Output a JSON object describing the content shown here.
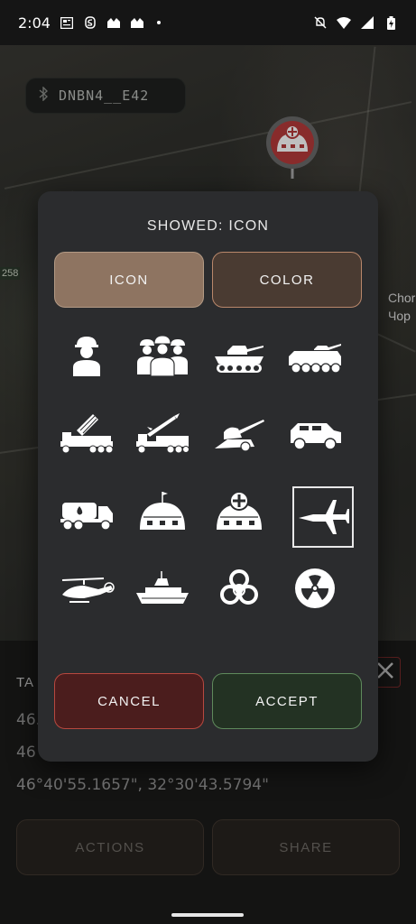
{
  "status_bar": {
    "time": "2:04",
    "left_icons": [
      "newspaper-icon",
      "s-app-icon",
      "sports-icon",
      "sports-icon",
      "dot-icon"
    ],
    "right_icons": [
      "mute-icon",
      "wifi-icon",
      "signal-icon",
      "battery-icon"
    ]
  },
  "map": {
    "device_chip": {
      "icon": "bluetooth-icon",
      "label": "DNBN4__E42"
    },
    "marker_icon": "field-hospital-icon",
    "side_text": [
      "Chor",
      "Чор"
    ],
    "number_tag": "258"
  },
  "bottom_panel": {
    "tag_label": "TA",
    "coords": [
      "46.",
      "46",
      "46°40'55.1657\", 32°30'43.5794\""
    ],
    "actions_label": "ACTIONS",
    "share_label": "SHARE"
  },
  "dialog": {
    "title": "SHOWED: ICON",
    "tab_icon_label": "ICON",
    "tab_color_label": "COLOR",
    "icons": [
      {
        "name": "soldier-icon",
        "selected": false
      },
      {
        "name": "squad-icon",
        "selected": false
      },
      {
        "name": "tank-icon",
        "selected": false
      },
      {
        "name": "apc-icon",
        "selected": false
      },
      {
        "name": "rocket-launcher-truck-icon",
        "selected": false
      },
      {
        "name": "missile-truck-icon",
        "selected": false
      },
      {
        "name": "artillery-icon",
        "selected": false
      },
      {
        "name": "armored-vehicle-icon",
        "selected": false
      },
      {
        "name": "fuel-truck-icon",
        "selected": false
      },
      {
        "name": "hangar-icon",
        "selected": false
      },
      {
        "name": "field-hospital-icon",
        "selected": false
      },
      {
        "name": "fighter-jet-icon",
        "selected": true
      },
      {
        "name": "helicopter-icon",
        "selected": false
      },
      {
        "name": "warship-icon",
        "selected": false
      },
      {
        "name": "biohazard-icon",
        "selected": false
      },
      {
        "name": "radiation-icon",
        "selected": false
      }
    ],
    "cancel_label": "CANCEL",
    "accept_label": "ACCEPT"
  },
  "colors": {
    "cancel_bg": "#4b1d1d",
    "accept_bg": "#233223",
    "icon_tab_bg": "#8e7461",
    "color_tab_bg": "#4a3b32",
    "dialog_bg": "#2b2c2e"
  }
}
